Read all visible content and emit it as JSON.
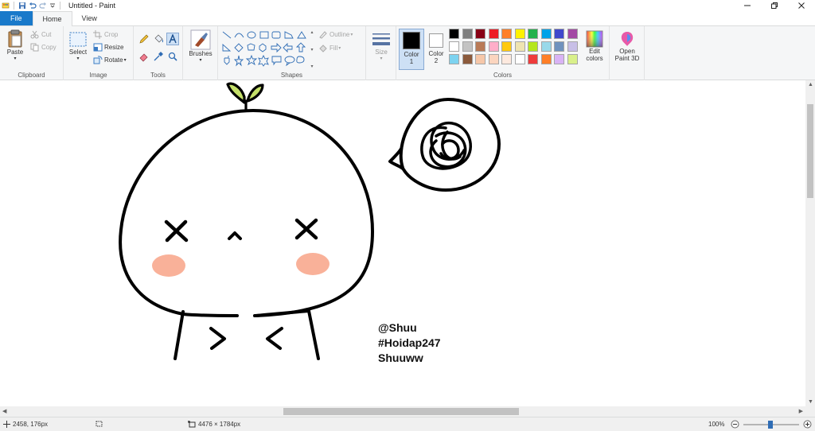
{
  "window": {
    "title": "Untitled - Paint"
  },
  "tabs": [
    {
      "label": "File"
    },
    {
      "label": "Home"
    },
    {
      "label": "View"
    }
  ],
  "ribbon": {
    "clipboard": {
      "label": "Clipboard",
      "paste": "Paste",
      "cut": "Cut",
      "copy": "Copy"
    },
    "image": {
      "label": "Image",
      "select": "Select",
      "crop": "Crop",
      "resize": "Resize",
      "rotate": "Rotate"
    },
    "tools": {
      "label": "Tools"
    },
    "brushes": {
      "label": "Brushes"
    },
    "shapes": {
      "label": "Shapes",
      "outline": "Outline",
      "fill": "Fill"
    },
    "size": {
      "label": "Size"
    },
    "color1": {
      "label": "Color 1",
      "value": "#000000"
    },
    "color2": {
      "label": "Color 2",
      "value": "#ffffff"
    },
    "colors": {
      "label": "Colors"
    },
    "edit_colors": "Edit colors",
    "open_paint3d": "Open Paint 3D"
  },
  "palette": [
    [
      "#000000",
      "#7f7f7f",
      "#880015",
      "#ed1c24",
      "#ff7f27",
      "#fff200",
      "#22b14c",
      "#00a2e8",
      "#3f48cc",
      "#a349a4"
    ],
    [
      "#ffffff",
      "#c3c3c3",
      "#b97a57",
      "#ffaec9",
      "#ffc90e",
      "#efe4b0",
      "#b5e61d",
      "#99d9ea",
      "#7092be",
      "#c8bfe7"
    ],
    [
      "#7dd3f0",
      "#8b5a3c",
      "#f6c7a9",
      "#fbd5bf",
      "#fde9de",
      "#ffffff",
      "#ee3b3b",
      "#ff7f27",
      "#d9b3f5",
      "#d9f08a"
    ]
  ],
  "canvas": {
    "text_lines": [
      "@Shuu",
      "#Hoidap247",
      "Shuuww"
    ],
    "blush_color": "#f9b199",
    "sprout_color": "#c5e06a"
  },
  "status": {
    "cursor_pos": "2458, 176px",
    "image_size": "4476 × 1784px",
    "zoom": "100%"
  }
}
